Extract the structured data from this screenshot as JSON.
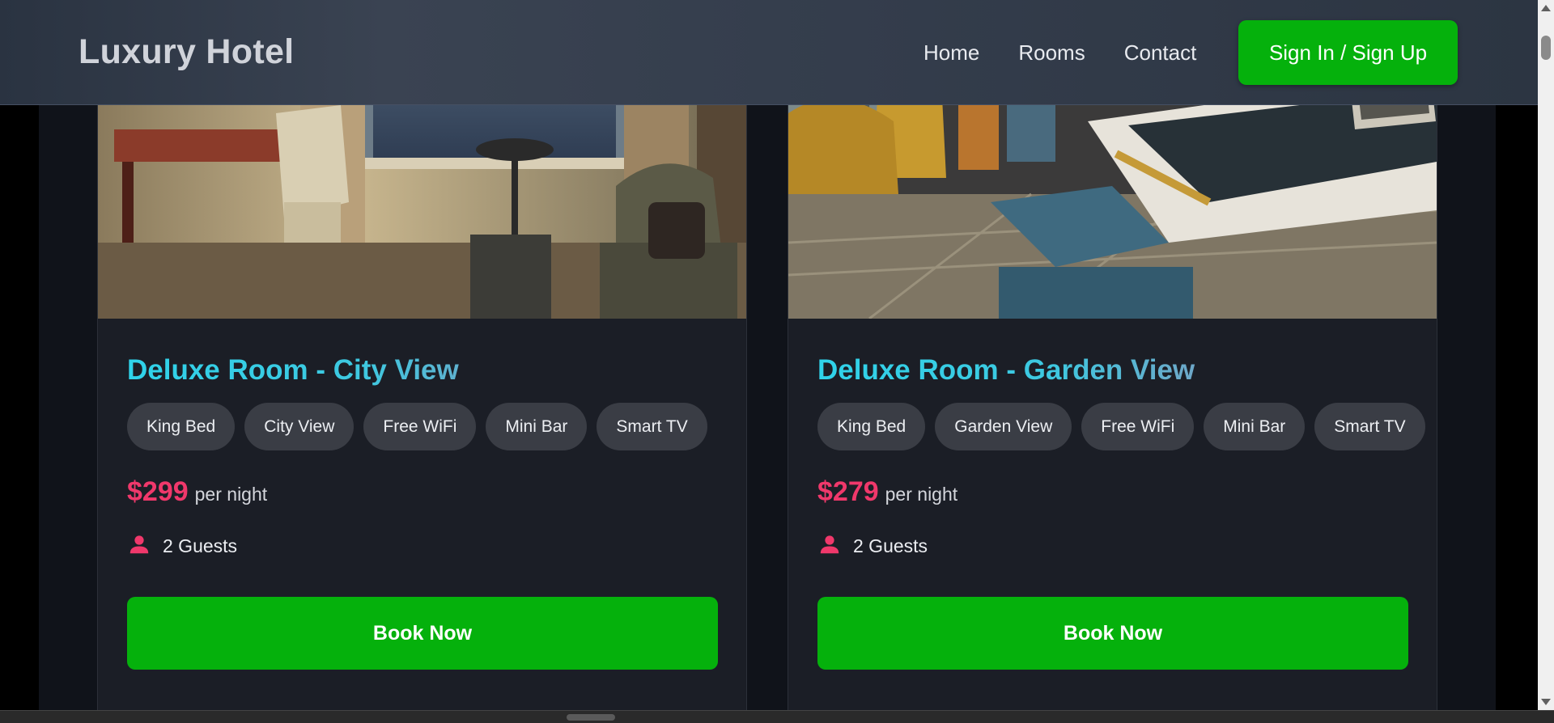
{
  "navbar": {
    "brand": "Luxury Hotel",
    "links": [
      "Home",
      "Rooms",
      "Contact"
    ],
    "signin_label": "Sign In / Sign Up"
  },
  "rooms": [
    {
      "title": "Deluxe Room - City View",
      "amenities": [
        "King Bed",
        "City View",
        "Free WiFi",
        "Mini Bar",
        "Smart TV"
      ],
      "price": "$299",
      "price_unit": "per night",
      "guests": "2 Guests",
      "book_label": "Book Now"
    },
    {
      "title": "Deluxe Room - Garden View",
      "amenities": [
        "King Bed",
        "Garden View",
        "Free WiFi",
        "Mini Bar",
        "Smart TV"
      ],
      "price": "$279",
      "price_unit": "per night",
      "guests": "2 Guests",
      "book_label": "Book Now"
    }
  ],
  "icons": {
    "guests": "person-icon"
  },
  "colors": {
    "accent_green": "#05b10c",
    "price_pink": "#f0386b",
    "title_cyan": "#2fd3ea"
  }
}
